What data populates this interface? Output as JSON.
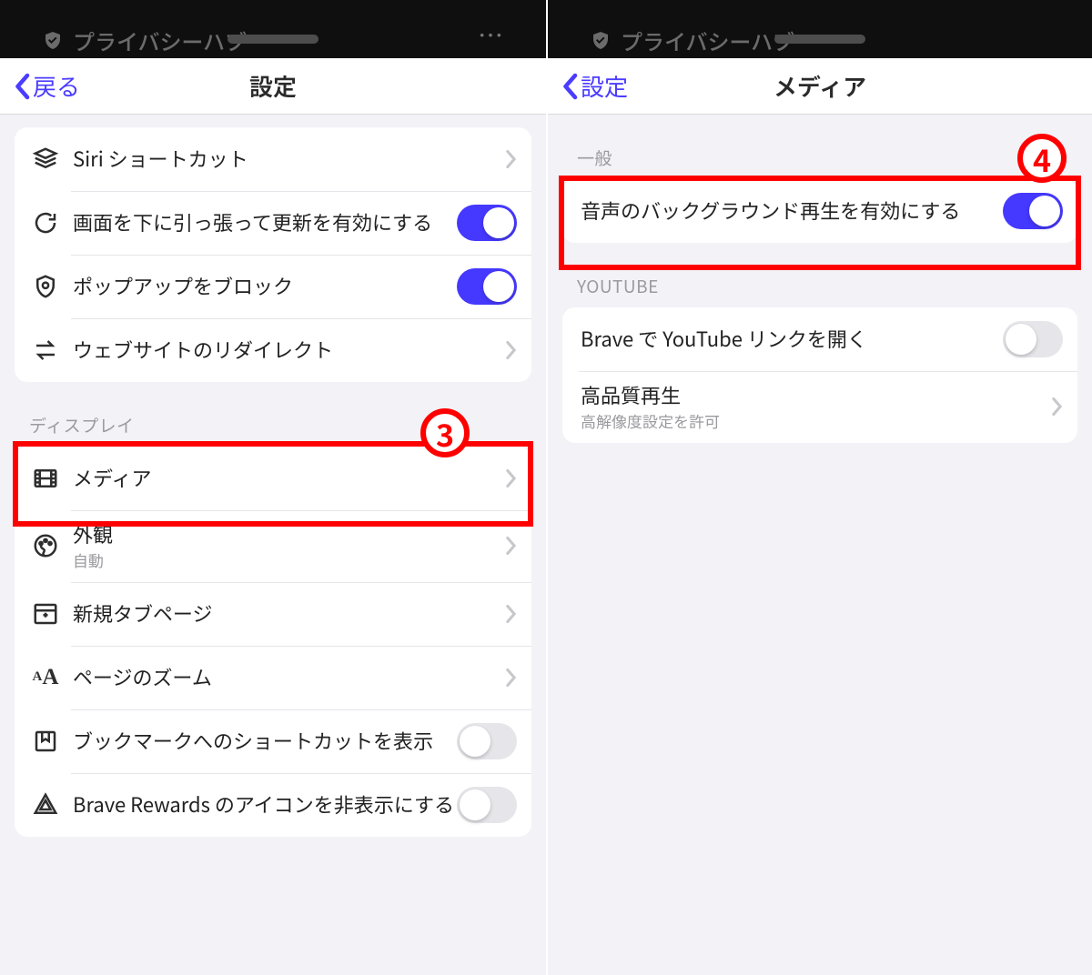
{
  "status_bar": {
    "label": "プライバシーハブ",
    "more_label": "⋯"
  },
  "left": {
    "nav": {
      "back": "戻る",
      "title": "設定"
    },
    "group1": [
      {
        "label": "Siri ショートカット",
        "type": "chev"
      },
      {
        "label": "画面を下に引っ張って更新を有効にする",
        "type": "toggle_on"
      },
      {
        "label": "ポップアップをブロック",
        "type": "toggle_on"
      },
      {
        "label": "ウェブサイトのリダイレクト",
        "type": "chev"
      }
    ],
    "sect_display": "ディスプレイ",
    "group2": [
      {
        "label": "メディア",
        "type": "chev"
      },
      {
        "label": "外観",
        "sub": "自動",
        "type": "chev"
      },
      {
        "label": "新規タブページ",
        "type": "chev"
      },
      {
        "label": "ページのズーム",
        "type": "chev"
      },
      {
        "label": "ブックマークへのショートカットを表示",
        "type": "toggle_off"
      },
      {
        "label": "Brave Rewards のアイコンを非表示にする",
        "type": "toggle_off"
      }
    ]
  },
  "right": {
    "nav": {
      "back": "設定",
      "title": "メディア"
    },
    "sect_general": "一般",
    "general": [
      {
        "label": "音声のバックグラウンド再生を有効にする",
        "type": "toggle_on"
      }
    ],
    "sect_youtube": "YOUTUBE",
    "youtube": [
      {
        "label": "Brave で YouTube リンクを開く",
        "type": "toggle_off"
      },
      {
        "label": "高品質再生",
        "sub": "高解像度設定を許可",
        "type": "chev"
      }
    ]
  },
  "annotations": {
    "badge3": "3",
    "badge4": "4"
  }
}
